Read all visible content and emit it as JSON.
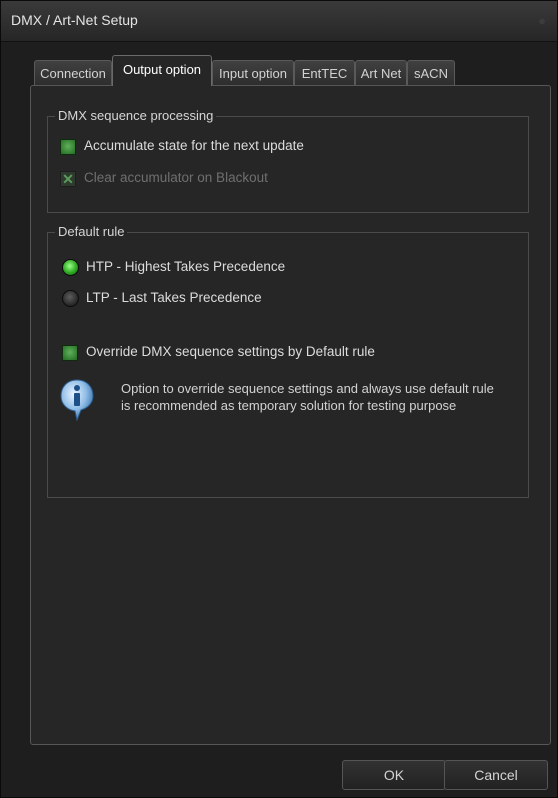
{
  "window": {
    "title": "DMX / Art-Net Setup",
    "title_icon": "pin-icon"
  },
  "tabs": [
    {
      "label": "Connection"
    },
    {
      "label": "Output option"
    },
    {
      "label": "Input option"
    },
    {
      "label": "EntTEC"
    },
    {
      "label": "Art Net"
    },
    {
      "label": "sACN"
    }
  ],
  "active_tab": "Output option",
  "dmx_sequence": {
    "legend": "DMX sequence processing",
    "accumulate_label": "Accumulate state for the next update",
    "accumulate_checked": true,
    "clear_label": "Clear accumulator on Blackout",
    "clear_checked": true,
    "clear_enabled": false
  },
  "default_rule": {
    "legend": "Default rule",
    "options": [
      {
        "label": "HTP - Highest Takes Precedence",
        "selected": true
      },
      {
        "label": "LTP - Last Takes Precedence",
        "selected": false
      }
    ],
    "override_label": "Override DMX sequence settings by Default rule",
    "override_checked": true,
    "info_line1": "Option to override sequence settings and always use default rule",
    "info_line2": "is recommended as temporary solution for testing purpose",
    "info_icon": "info-icon"
  },
  "buttons": {
    "ok": "OK",
    "cancel": "Cancel"
  },
  "colors": {
    "check_green": "#3d8f38",
    "radio_on": "#2eaa22",
    "background": "#1e1e1e"
  }
}
